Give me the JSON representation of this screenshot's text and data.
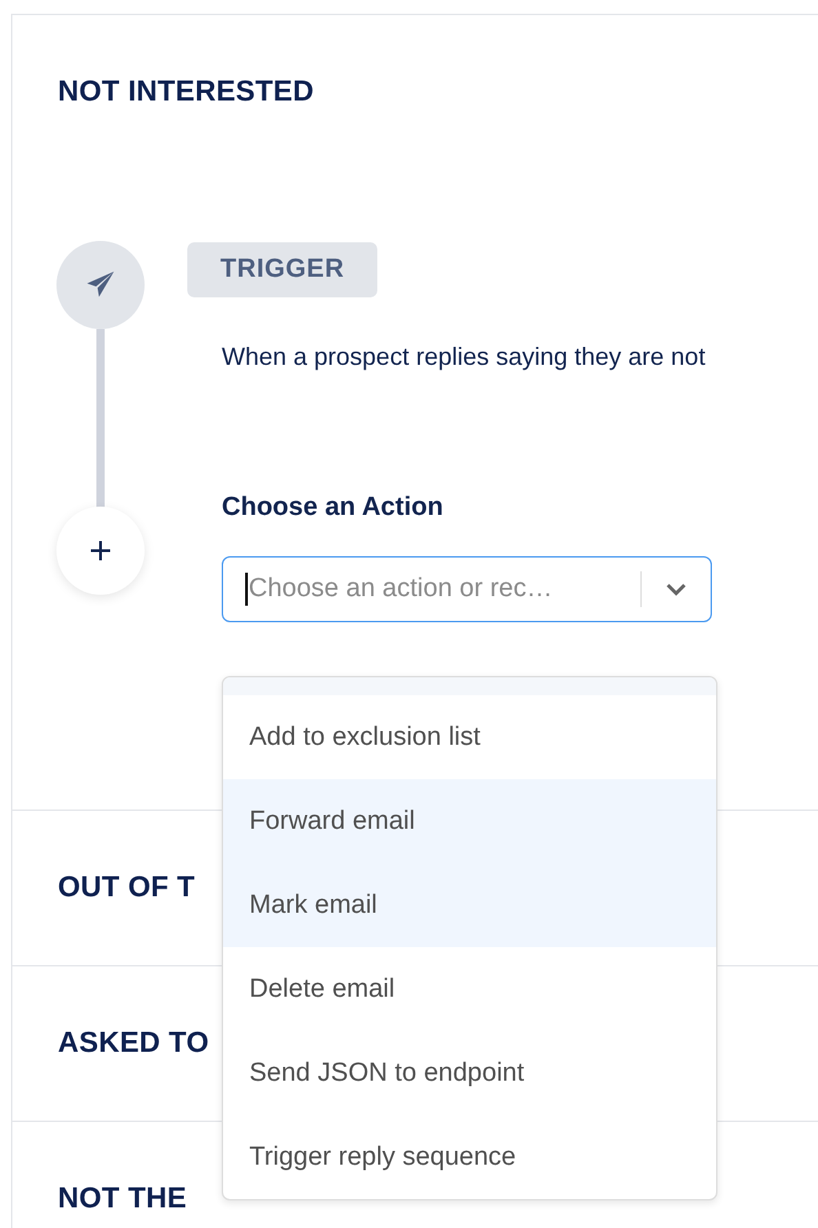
{
  "sections": [
    {
      "title": "NOT INTERESTED",
      "trigger": {
        "badge": "TRIGGER",
        "description": "When a prospect replies saying they are not"
      },
      "action": {
        "label": "Choose an Action",
        "placeholder": "Choose an action or rec…",
        "menu": [
          {
            "label": "Add to exclusion list",
            "highlighted": false
          },
          {
            "label": "Forward email",
            "highlighted": true
          },
          {
            "label": "Mark email",
            "highlighted": true
          },
          {
            "label": "Delete email",
            "highlighted": false
          },
          {
            "label": "Send JSON to endpoint",
            "highlighted": false
          },
          {
            "label": "Trigger reply sequence",
            "highlighted": false
          }
        ]
      }
    },
    {
      "title": "OUT OF T"
    },
    {
      "title": "ASKED TO"
    },
    {
      "title": "NOT THE"
    }
  ]
}
